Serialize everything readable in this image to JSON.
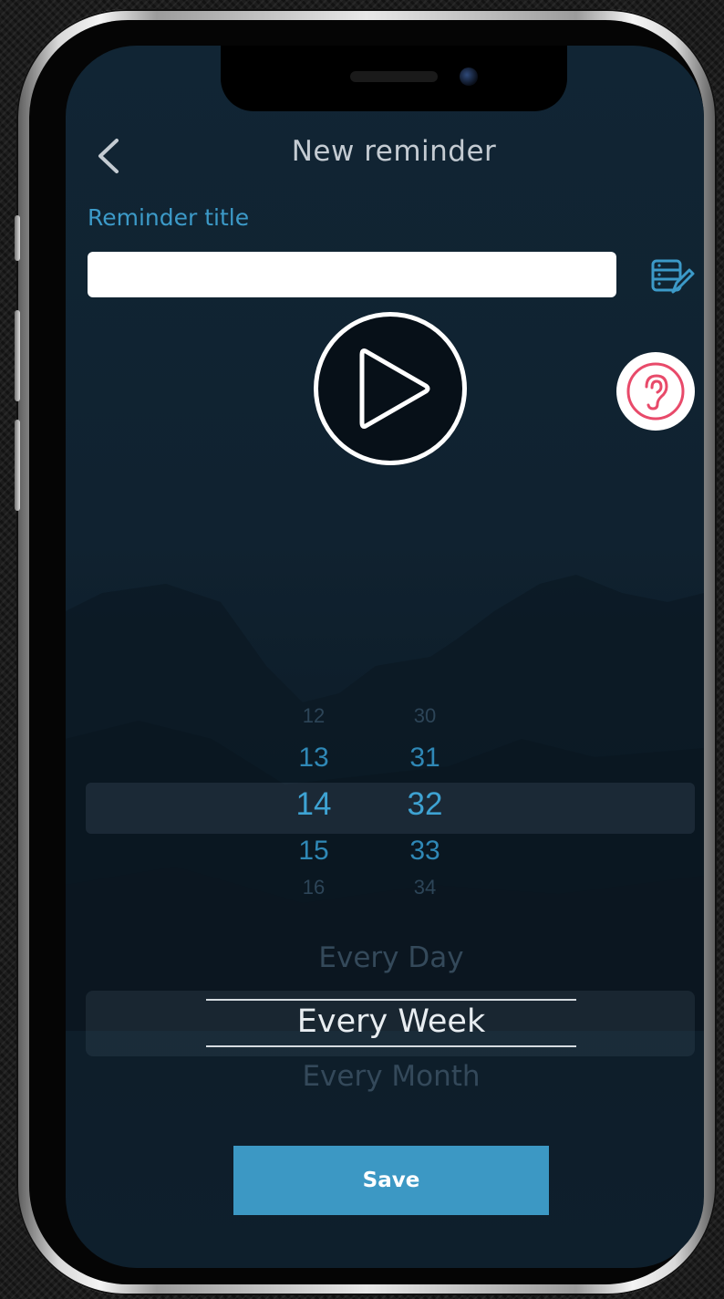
{
  "header": {
    "title": "New reminder",
    "back_icon": "chevron-left-icon"
  },
  "reminder_title": {
    "label": "Reminder title",
    "value": "",
    "placeholder": ""
  },
  "toolbar": {
    "notes_icon": "edit-list-icon",
    "play_icon": "play-icon",
    "listen_icon": "ear-icon"
  },
  "time_picker": {
    "hours": [
      "12",
      "13",
      "14",
      "15",
      "16"
    ],
    "minutes": [
      "30",
      "31",
      "32",
      "33",
      "34"
    ],
    "selected_hour": "14",
    "selected_minute": "32"
  },
  "repeat_picker": {
    "options": [
      "Every Day",
      "Every Week",
      "Every Month"
    ],
    "selected": "Every Week"
  },
  "save_label": "Save",
  "colors": {
    "accent": "#3c98c4",
    "label": "#3c9ac8",
    "ear_icon": "#e84a6a",
    "background": "#112534"
  }
}
